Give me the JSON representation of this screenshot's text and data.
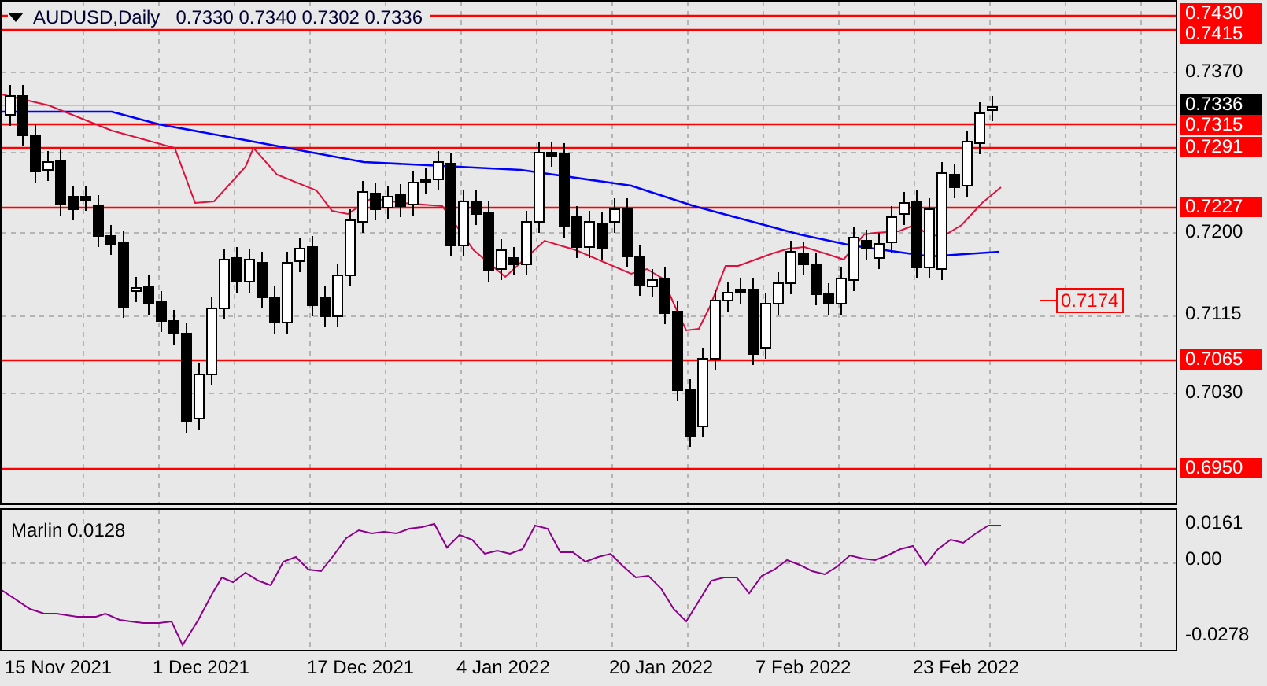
{
  "header": {
    "symbol": "AUDUSD,Daily",
    "ohlc": "0.7330 0.7340 0.7302 0.7336"
  },
  "price_axis": [
    {
      "text": "0.7430",
      "kind": "level"
    },
    {
      "text": "0.7415",
      "kind": "level"
    },
    {
      "text": "0.7370",
      "kind": "tick"
    },
    {
      "text": "0.7336",
      "kind": "current"
    },
    {
      "text": "0.7315",
      "kind": "level"
    },
    {
      "text": "0.7291",
      "kind": "level"
    },
    {
      "text": "0.7227",
      "kind": "level"
    },
    {
      "text": "0.7200",
      "kind": "tick"
    },
    {
      "text": "0.7115",
      "kind": "tick"
    },
    {
      "text": "0.7065",
      "kind": "level"
    },
    {
      "text": "0.7030",
      "kind": "tick"
    },
    {
      "text": "0.6950",
      "kind": "level"
    }
  ],
  "projection_label": "0.7174",
  "indicator": {
    "name": "Marlin 0.0128",
    "ticks": [
      "0.0161",
      "0.00",
      "-0.0278"
    ]
  },
  "dates": [
    "15 Nov 2021",
    "1 Dec 2021",
    "17 Dec 2021",
    "4 Jan 2022",
    "20 Jan 2022",
    "7 Feb 2022",
    "23 Feb 2022"
  ]
}
